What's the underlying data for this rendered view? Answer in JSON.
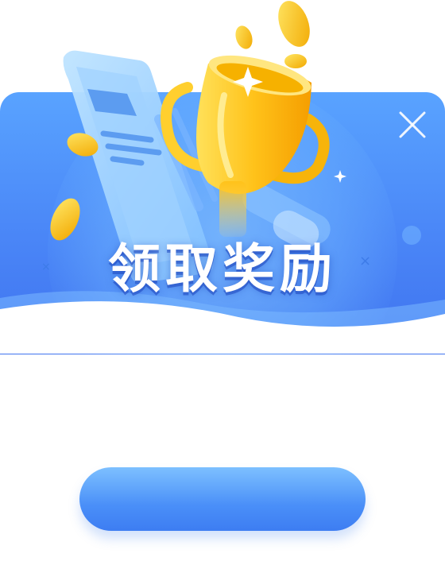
{
  "dialog": {
    "title": "领取奖励",
    "close_icon": "close-icon",
    "button_label": "",
    "colors": {
      "header_top": "#59a3ff",
      "header_bottom": "#3f73ef",
      "button_top": "#7dc0ff",
      "button_bottom": "#3d7df2",
      "trophy": "#ffc820"
    },
    "illustration_icons": [
      "phone-icon",
      "trophy-icon",
      "coin-icon",
      "sparkle-icon"
    ]
  }
}
